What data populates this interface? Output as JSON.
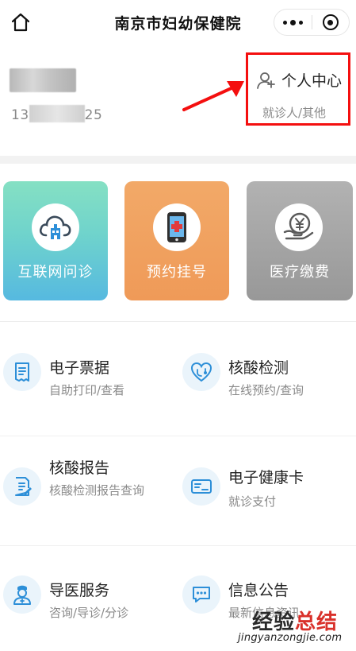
{
  "navbar": {
    "title": "南京市妇幼保健院",
    "home_icon": "home-icon",
    "more_icon": "more-dots-icon",
    "close_icon": "target-close-icon"
  },
  "user": {
    "name": "",
    "phone_prefix": "13",
    "phone_suffix": "25"
  },
  "personal_center": {
    "label": "个人中心",
    "sub": "就诊人/其他",
    "icon": "user-plus-icon",
    "highlight_color": "#f40f0f"
  },
  "cards": [
    {
      "label": "互联网问诊",
      "icon": "cloud-hospital-icon",
      "color": "#6fd3cc"
    },
    {
      "label": "预约挂号",
      "icon": "phone-medical-icon",
      "color": "#ef9a58"
    },
    {
      "label": "医疗缴费",
      "icon": "yuan-hand-icon",
      "color": "#a3a3a3"
    }
  ],
  "services": [
    {
      "title": "电子票据",
      "sub": "自助打印/查看",
      "icon": "receipt-icon"
    },
    {
      "title": "核酸检测",
      "sub": "在线预约/查询",
      "icon": "stethoscope-heart-icon"
    },
    {
      "title": "核酸报告",
      "sub": "核酸检测报告查询",
      "icon": "report-edit-icon"
    },
    {
      "title": "电子健康卡",
      "sub": "就诊支付",
      "icon": "health-card-icon"
    },
    {
      "title": "导医服务",
      "sub": "咨询/导诊/分诊",
      "icon": "nurse-icon"
    },
    {
      "title": "信息公告",
      "sub": "最新信息资讯",
      "icon": "chat-bubble-icon"
    }
  ],
  "watermark": {
    "title_part1": "经验",
    "title_part2": "总结",
    "url": "jingyanzongjie.com"
  },
  "colors": {
    "accent_blue": "#2d8fd8",
    "icon_bg": "#eaf4fb"
  }
}
